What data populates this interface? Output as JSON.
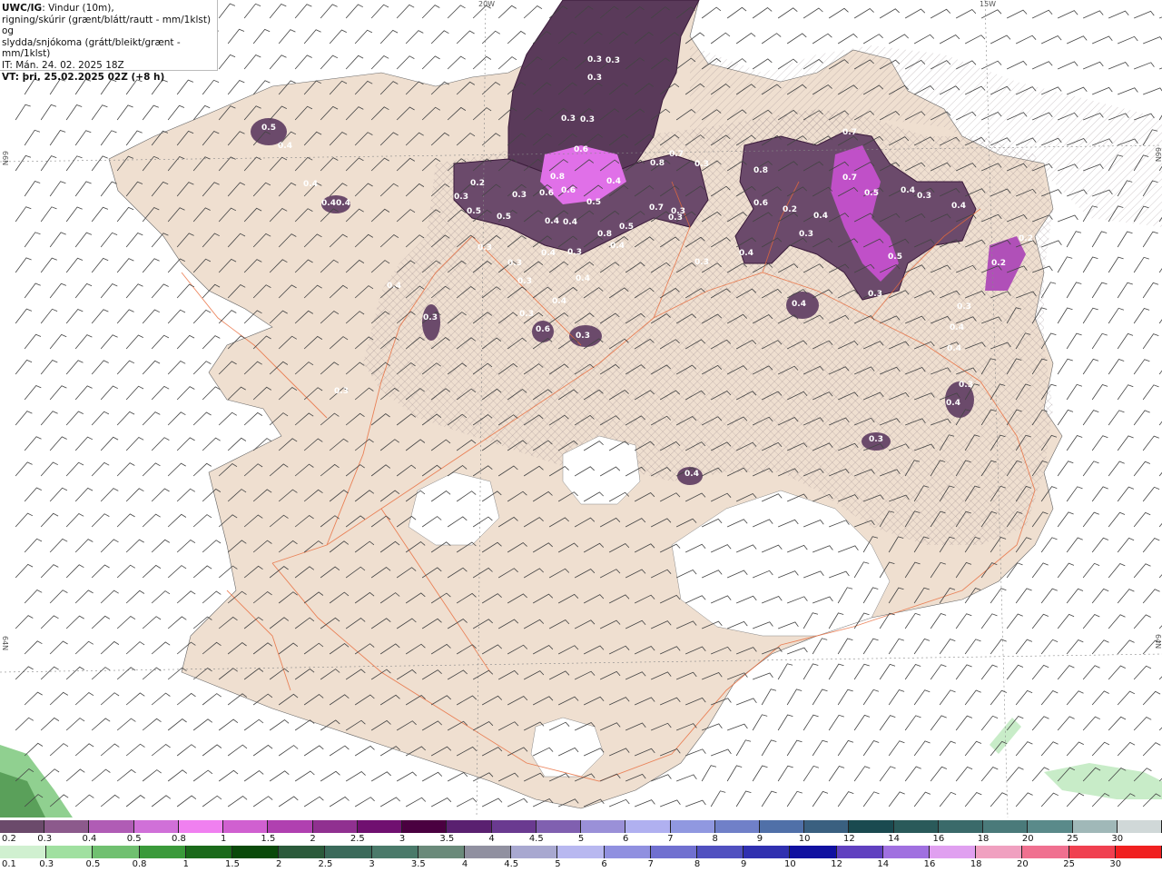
{
  "header": {
    "model": "UWC/IG",
    "desc_line1": ": Vindur (10m),",
    "desc_line2": "rigning/skúrir (grænt/blátt/rautt - mm/1klst) og",
    "desc_line3": "slydda/snjókoma (grátt/bleikt/grænt - mm/1klst)",
    "it_line": "IT: Mán. 24. 02. 2025 18Z",
    "vt_line": "VT: þri. 25.02.2025 02Z (+8 h)"
  },
  "coordinates": {
    "top_lon1": "20W",
    "top_lon2": "15W",
    "left_lat1": "66N",
    "left_lat2": "64N",
    "right_lat1": "66N",
    "right_lat2": "64N"
  },
  "precip_labels": [
    "0.3",
    "0.3",
    "0.3",
    "0.3",
    "0.3",
    "0.5",
    "0.4",
    "0.4",
    "0.4",
    "0.4",
    "0.2",
    "0.3",
    "0.3",
    "0.6",
    "0.8",
    "0.6",
    "0.5",
    "0.8",
    "0.7",
    "0.8",
    "0.6",
    "0.4",
    "0.5",
    "0.3",
    "0.3",
    "0.4",
    "0.4",
    "0.5",
    "0.5",
    "0.3",
    "0.3",
    "0.8",
    "0.7",
    "0.4",
    "0.3",
    "0.6",
    "0.4",
    "0.4",
    "0.3",
    "0.7",
    "0.5",
    "0.4",
    "0.3",
    "0.4",
    "0.7",
    "0.5",
    "0.3",
    "0.4",
    "0.2",
    "0.3",
    "0.4",
    "0.3",
    "0.3",
    "0.2",
    "0.2",
    "0.3",
    "0.4",
    "0.6",
    "0.3",
    "0.4",
    "0.3",
    "0.4",
    "0.4",
    "0.3",
    "0.4",
    "0.3",
    "0.4",
    "0.3",
    "0.4",
    "0.3"
  ],
  "legend_snow": {
    "ticks": [
      "0.2",
      "0.3",
      "0.4",
      "0.5",
      "0.8",
      "1",
      "1.5",
      "2",
      "2.5",
      "3",
      "3.5",
      "4",
      "4.5",
      "5",
      "6",
      "7",
      "8",
      "9",
      "10",
      "12",
      "14",
      "16",
      "18",
      "20",
      "25",
      "30"
    ],
    "colors": [
      "#6b4a6b",
      "#8c5a8c",
      "#b05cb5",
      "#d070d8",
      "#f080f0",
      "#d060d0",
      "#b040b0",
      "#903090",
      "#701070",
      "#4a0040",
      "#5a2070",
      "#6a3a90",
      "#8060b0",
      "#9a90d8",
      "#b0b0f0",
      "#9098e0",
      "#7080c8",
      "#5070a8",
      "#3a6080",
      "#1a4a50",
      "#2a5a5a",
      "#3a6a6a",
      "#4a7a7a",
      "#5a8a8a",
      "#a0b8b8",
      "#d0d8d8"
    ]
  },
  "legend_rain": {
    "ticks": [
      "0.1",
      "0.3",
      "0.5",
      "0.8",
      "1",
      "1.5",
      "2",
      "2.5",
      "3",
      "3.5",
      "4",
      "4.5",
      "5",
      "6",
      "7",
      "8",
      "9",
      "10",
      "12",
      "14",
      "16",
      "18",
      "20",
      "25",
      "30"
    ],
    "colors": [
      "#d0f0d0",
      "#a0e0a0",
      "#70c070",
      "#3a9a3a",
      "#1a6a1a",
      "#0a4a0a",
      "#2a5a3a",
      "#3a6a5a",
      "#4a7a6a",
      "#6a8a7a",
      "#9090a0",
      "#a8a8d0",
      "#b8b8f0",
      "#9090e0",
      "#7070d0",
      "#5050c0",
      "#3030b0",
      "#1010a0",
      "#6040c0",
      "#a070e0",
      "#e0a0f0",
      "#f0a0c0",
      "#f07090",
      "#f04050",
      "#f02020"
    ]
  }
}
